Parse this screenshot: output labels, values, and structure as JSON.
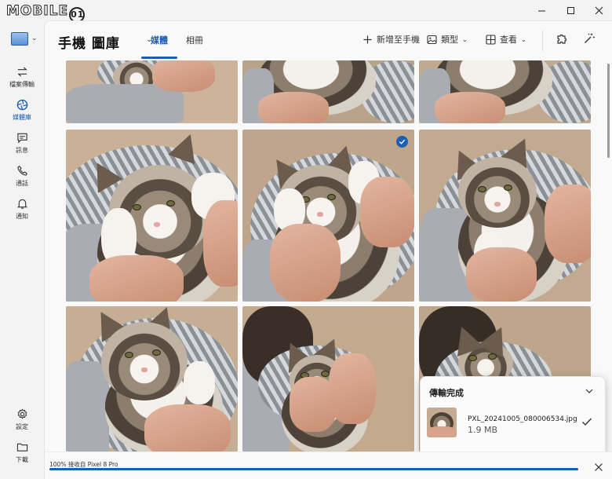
{
  "titlebar": {
    "watermark": "MOBILE",
    "watermark_badge": "01"
  },
  "rail": {
    "items": [
      {
        "label": "檔案傳輸",
        "icon": "transfer-icon"
      },
      {
        "label": "媒體庫",
        "icon": "media-library-icon"
      },
      {
        "label": "訊息",
        "icon": "message-icon"
      },
      {
        "label": "通話",
        "icon": "phone-icon"
      },
      {
        "label": "通知",
        "icon": "bell-icon"
      }
    ],
    "bottom_items": [
      {
        "label": "設定",
        "icon": "gear-icon"
      },
      {
        "label": "下載",
        "icon": "folder-icon"
      }
    ]
  },
  "header": {
    "title": "手機 圖庫",
    "tabs": [
      {
        "label": "媒體",
        "active": true
      },
      {
        "label": "相冊",
        "active": false
      }
    ],
    "tools": {
      "add_label": "新增至手機",
      "type_label": "類型",
      "view_label": "查看"
    }
  },
  "toast": {
    "title": "傳輸完成",
    "file_name": "PXL_20241005_080006534.jpg",
    "file_size": "1.9 MB"
  },
  "status": {
    "text": "100% 接收自 Pixel 8 Pro",
    "progress": 1.0
  },
  "colors": {
    "accent": "#1a5fb4",
    "background": "#f3f3f3"
  }
}
